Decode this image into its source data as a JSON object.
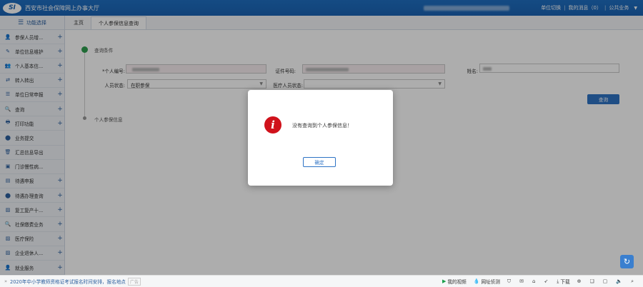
{
  "header": {
    "logo_badge": "SI",
    "title": "西安市社会保障网上办事大厅",
    "links": [
      "单位切换",
      "我的消息（0）",
      "公共业务"
    ]
  },
  "sidebar": {
    "toggle_label": "功能选择",
    "items": [
      {
        "label": "参保人员增...",
        "icon": "person-plus-icon",
        "glyph": "👤",
        "plus": true
      },
      {
        "label": "单位信息维护",
        "icon": "document-edit-icon",
        "glyph": "✎",
        "plus": true
      },
      {
        "label": "个人基本信...",
        "icon": "person-card-icon",
        "glyph": "👥",
        "plus": true
      },
      {
        "label": "转入转出",
        "icon": "transfer-icon",
        "glyph": "⇄",
        "plus": true
      },
      {
        "label": "单位日常申报",
        "icon": "list-icon",
        "glyph": "☰",
        "plus": true
      },
      {
        "label": "查询",
        "icon": "search-icon",
        "glyph": "🔍",
        "plus": true
      },
      {
        "label": "打印功能",
        "icon": "printer-icon",
        "glyph": "🖶",
        "plus": true
      },
      {
        "label": "业务提交",
        "icon": "submit-icon",
        "glyph": "⬤",
        "plus": false
      },
      {
        "label": "汇总信息导出",
        "icon": "export-icon",
        "glyph": "🗑",
        "plus": false
      },
      {
        "label": "门诊慢性病...",
        "icon": "clinic-icon",
        "glyph": "▣",
        "plus": false
      },
      {
        "label": "待遇申报",
        "icon": "benefit-icon",
        "glyph": "▤",
        "plus": true
      },
      {
        "label": "待遇办理查询",
        "icon": "benefit-search-icon",
        "glyph": "⬤",
        "plus": true
      },
      {
        "label": "复工复产十...",
        "icon": "image-icon",
        "glyph": "▨",
        "plus": true
      },
      {
        "label": "社保缴费业务",
        "icon": "payment-search-icon",
        "glyph": "🔍",
        "plus": true
      },
      {
        "label": "医疗保险",
        "icon": "medical-icon",
        "glyph": "▨",
        "plus": true
      },
      {
        "label": "企业退休人...",
        "icon": "retire-icon",
        "glyph": "▨",
        "plus": true
      },
      {
        "label": "就业服务",
        "icon": "employment-icon",
        "glyph": "👤",
        "plus": true
      }
    ]
  },
  "tabs": [
    "主页",
    "个人参保信息查询"
  ],
  "main": {
    "section_query": "查询条件",
    "section_info": "个人参保信息",
    "fields": {
      "person_no_label": "*个人编号:",
      "cert_no_label": "证件号码:",
      "name_label": "姓名:",
      "status_label": "人员状态:",
      "status_value": "在职参保",
      "medical_status_label": "医疗人员状态:",
      "medical_status_value": ""
    },
    "query_button": "查询"
  },
  "modal": {
    "icon_glyph": "i",
    "message": "没有查询到个人参保信息！",
    "ok_button": "确定"
  },
  "statusbar": {
    "news": "2020年中小学教师资格证考试报名时间安排，报名地点",
    "news_tag": "广告",
    "items": [
      {
        "label": "我的视频",
        "icon": "video-icon",
        "glyph": "▶",
        "cls": "green"
      },
      {
        "label": "网址侦测",
        "icon": "drop-icon",
        "glyph": "💧",
        "cls": "teal"
      },
      {
        "label": "",
        "icon": "shield-icon",
        "glyph": "⛉",
        "cls": ""
      },
      {
        "label": "",
        "icon": "mail-icon",
        "glyph": "✉",
        "cls": ""
      },
      {
        "label": "",
        "icon": "tag-icon",
        "glyph": "⌂",
        "cls": ""
      },
      {
        "label": "",
        "icon": "rocket-icon",
        "glyph": "➶",
        "cls": ""
      },
      {
        "label": "下载",
        "icon": "download-icon",
        "glyph": "⤓",
        "cls": ""
      },
      {
        "label": "",
        "icon": "game-icon",
        "glyph": "⊕",
        "cls": ""
      },
      {
        "label": "",
        "icon": "note-icon",
        "glyph": "❏",
        "cls": ""
      },
      {
        "label": "",
        "icon": "window-icon",
        "glyph": "▢",
        "cls": ""
      },
      {
        "label": "",
        "icon": "sound-icon",
        "glyph": "🔈",
        "cls": ""
      },
      {
        "label": "",
        "icon": "zoom-icon",
        "glyph": "⌕",
        "cls": ""
      }
    ]
  }
}
